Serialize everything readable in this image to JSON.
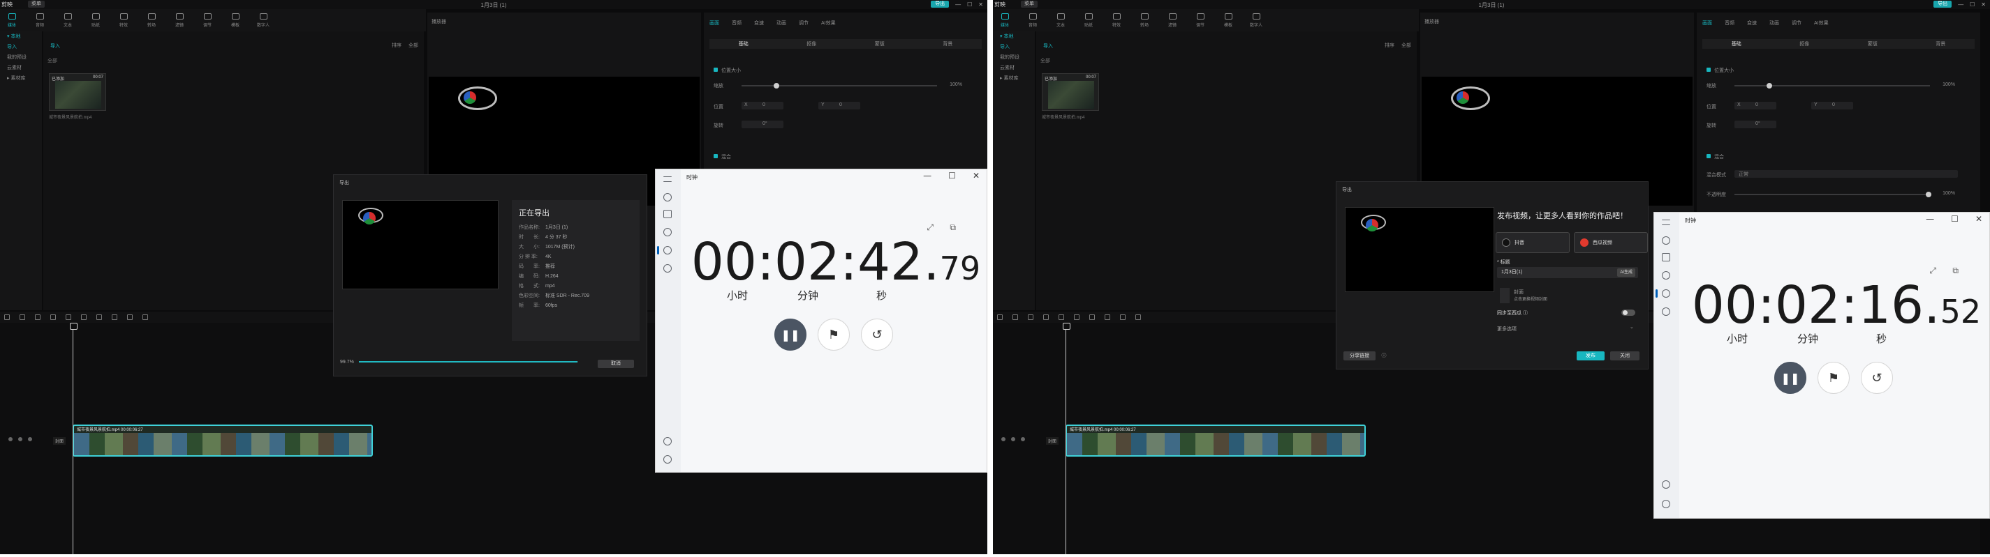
{
  "app": {
    "name": "剪映",
    "menu": "菜单",
    "project_title": "1月3日 (1)",
    "export_button": "导出",
    "window_controls": [
      "—",
      "☐",
      "✕"
    ]
  },
  "toolbar": [
    {
      "label": "媒体",
      "active": true
    },
    {
      "label": "音频"
    },
    {
      "label": "文本"
    },
    {
      "label": "贴纸"
    },
    {
      "label": "特效"
    },
    {
      "label": "转场"
    },
    {
      "label": "滤镜"
    },
    {
      "label": "调节"
    },
    {
      "label": "模板"
    },
    {
      "label": "数字人"
    }
  ],
  "left_panel": {
    "nav": [
      "▾ 本地",
      "导入",
      "我的预设",
      "云素材",
      "▸ 素材库"
    ],
    "header": "导入",
    "sub": "全部",
    "controls": [
      "排序",
      "全部"
    ],
    "thumb_added": "已添加",
    "thumb_duration": "00:07",
    "thumb_name": "城市夜景风景航拍.mp4"
  },
  "player": {
    "title": "播放器"
  },
  "props": {
    "tabs": [
      "画面",
      "音频",
      "变速",
      "动画",
      "调节",
      "AI效果"
    ],
    "subtabs": [
      "基础",
      "抠像",
      "蒙版",
      "背景"
    ],
    "section_size": "位置大小",
    "scale_label": "缩放",
    "scale_value": "100%",
    "pos_label": "位置",
    "x_label": "X",
    "x_value": "0",
    "y_label": "Y",
    "y_value": "0",
    "rotate_label": "旋转",
    "rotate_value": "0°",
    "section_blend": "混合",
    "blend_mode_label": "混合模式",
    "blend_mode_value": "正常",
    "opacity_label": "不透明度",
    "opacity_value": "100%"
  },
  "timeline": {
    "clip_label": "城市夜景风景航拍.mp4  00:00:06:27",
    "cover_label": "封面"
  },
  "export_dialog": {
    "title": "导出",
    "heading": "正在导出",
    "rows": [
      {
        "k": "作品名称:",
        "v": "1月3日 (1)"
      },
      {
        "k": "时　　长:",
        "v": "4 分 37 秒"
      },
      {
        "k": "大　　小:",
        "v": "1017M (预计)"
      },
      {
        "k": "分 辨 率:",
        "v": "4K"
      },
      {
        "k": "码　　率:",
        "v": "推荐"
      },
      {
        "k": "编　　码:",
        "v": "H.264"
      },
      {
        "k": "格　　式:",
        "v": "mp4"
      },
      {
        "k": "色彩空间:",
        "v": "标准 SDR - Rec.709"
      },
      {
        "k": "帧　　率:",
        "v": "60fps"
      }
    ],
    "progress_text": "99.7%",
    "progress": 0.997,
    "cancel": "取消"
  },
  "publish_dialog": {
    "title": "导出",
    "heading": "发布视频，让更多人看到你的作品吧！",
    "platforms": [
      "抖音",
      "西瓜视频"
    ],
    "title_label": "* 标题",
    "title_value": "1月3日(1)",
    "generate_btn": "AI生成",
    "cover_note": "封面",
    "cover_hint": "点击更换视频封面",
    "sync_label": "同步至西瓜 ⓘ",
    "more_label": "更多选项",
    "more_arrow": "⌄",
    "share_button": "分享链接",
    "help_mark": "ⓘ",
    "publish_button": "发布",
    "close_button": "关闭"
  },
  "clock_left": {
    "title": "时钟",
    "time_main": "00:02:42.",
    "time_frac": "79",
    "units": [
      "小时",
      "分钟",
      "秒"
    ]
  },
  "clock_right": {
    "title": "时钟",
    "time_main": "00:02:16.",
    "time_frac": "52",
    "units": [
      "小时",
      "分钟",
      "秒"
    ]
  },
  "icons": {
    "pause": "pause-icon",
    "flag": "flag-icon",
    "reset": "reset-icon",
    "expand": "expand-icon",
    "pin": "pin-icon"
  },
  "colors": {
    "accent": "#18b7c0",
    "dark_bg": "#0b0b0c",
    "clock_bg": "#f6f7f9",
    "pause_btn": "#4b5563"
  }
}
